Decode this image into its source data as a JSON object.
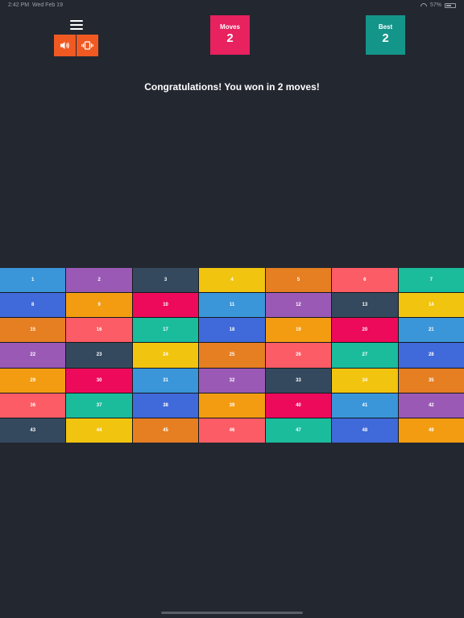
{
  "status_bar": {
    "time": "2:42 PM",
    "date": "Wed Feb 19",
    "battery": "57%",
    "battery_level": 0.57
  },
  "header": {
    "menu_icon": "hamburger-menu-icon",
    "sound_icon": "speaker-icon",
    "vibrate_icon": "vibrate-icon",
    "toggle_color": "#f05a22",
    "moves": {
      "label": "Moves",
      "value": "2",
      "color": "#e8215f"
    },
    "best": {
      "label": "Best",
      "value": "2",
      "color": "#14958a"
    }
  },
  "message": "Congratulations! You won in 2 moves!",
  "board": {
    "tiles": [
      {
        "label": "1",
        "color": "#3a96d9"
      },
      {
        "label": "2",
        "color": "#9b59b6"
      },
      {
        "label": "3",
        "color": "#34495e"
      },
      {
        "label": "4",
        "color": "#f1c40f"
      },
      {
        "label": "5",
        "color": "#e67e22"
      },
      {
        "label": "6",
        "color": "#fc5c65"
      },
      {
        "label": "7",
        "color": "#1abc9c"
      },
      {
        "label": "8",
        "color": "#4069d9"
      },
      {
        "label": "9",
        "color": "#f39c12"
      },
      {
        "label": "10",
        "color": "#ee0a5a"
      },
      {
        "label": "11",
        "color": "#3a96d9"
      },
      {
        "label": "12",
        "color": "#9b59b6"
      },
      {
        "label": "13",
        "color": "#34495e"
      },
      {
        "label": "14",
        "color": "#f1c40f"
      },
      {
        "label": "15",
        "color": "#e67e22"
      },
      {
        "label": "16",
        "color": "#fc5c65"
      },
      {
        "label": "17",
        "color": "#1abc9c"
      },
      {
        "label": "18",
        "color": "#4069d9"
      },
      {
        "label": "19",
        "color": "#f39c12"
      },
      {
        "label": "20",
        "color": "#ee0a5a"
      },
      {
        "label": "21",
        "color": "#3a96d9"
      },
      {
        "label": "22",
        "color": "#9b59b6"
      },
      {
        "label": "23",
        "color": "#34495e"
      },
      {
        "label": "24",
        "color": "#f1c40f"
      },
      {
        "label": "25",
        "color": "#e67e22"
      },
      {
        "label": "26",
        "color": "#fc5c65"
      },
      {
        "label": "27",
        "color": "#1abc9c"
      },
      {
        "label": "28",
        "color": "#4069d9"
      },
      {
        "label": "29",
        "color": "#f39c12"
      },
      {
        "label": "30",
        "color": "#ee0a5a"
      },
      {
        "label": "31",
        "color": "#3a96d9"
      },
      {
        "label": "32",
        "color": "#9b59b6"
      },
      {
        "label": "33",
        "color": "#34495e"
      },
      {
        "label": "34",
        "color": "#f1c40f"
      },
      {
        "label": "35",
        "color": "#e67e22"
      },
      {
        "label": "36",
        "color": "#fc5c65"
      },
      {
        "label": "37",
        "color": "#1abc9c"
      },
      {
        "label": "38",
        "color": "#4069d9"
      },
      {
        "label": "39",
        "color": "#f39c12"
      },
      {
        "label": "40",
        "color": "#ee0a5a"
      },
      {
        "label": "41",
        "color": "#3a96d9"
      },
      {
        "label": "42",
        "color": "#9b59b6"
      },
      {
        "label": "43",
        "color": "#34495e"
      },
      {
        "label": "44",
        "color": "#f1c40f"
      },
      {
        "label": "45",
        "color": "#e67e22"
      },
      {
        "label": "46",
        "color": "#fc5c65"
      },
      {
        "label": "47",
        "color": "#1abc9c"
      },
      {
        "label": "48",
        "color": "#4069d9"
      },
      {
        "label": "49",
        "color": "#f39c12"
      }
    ]
  }
}
